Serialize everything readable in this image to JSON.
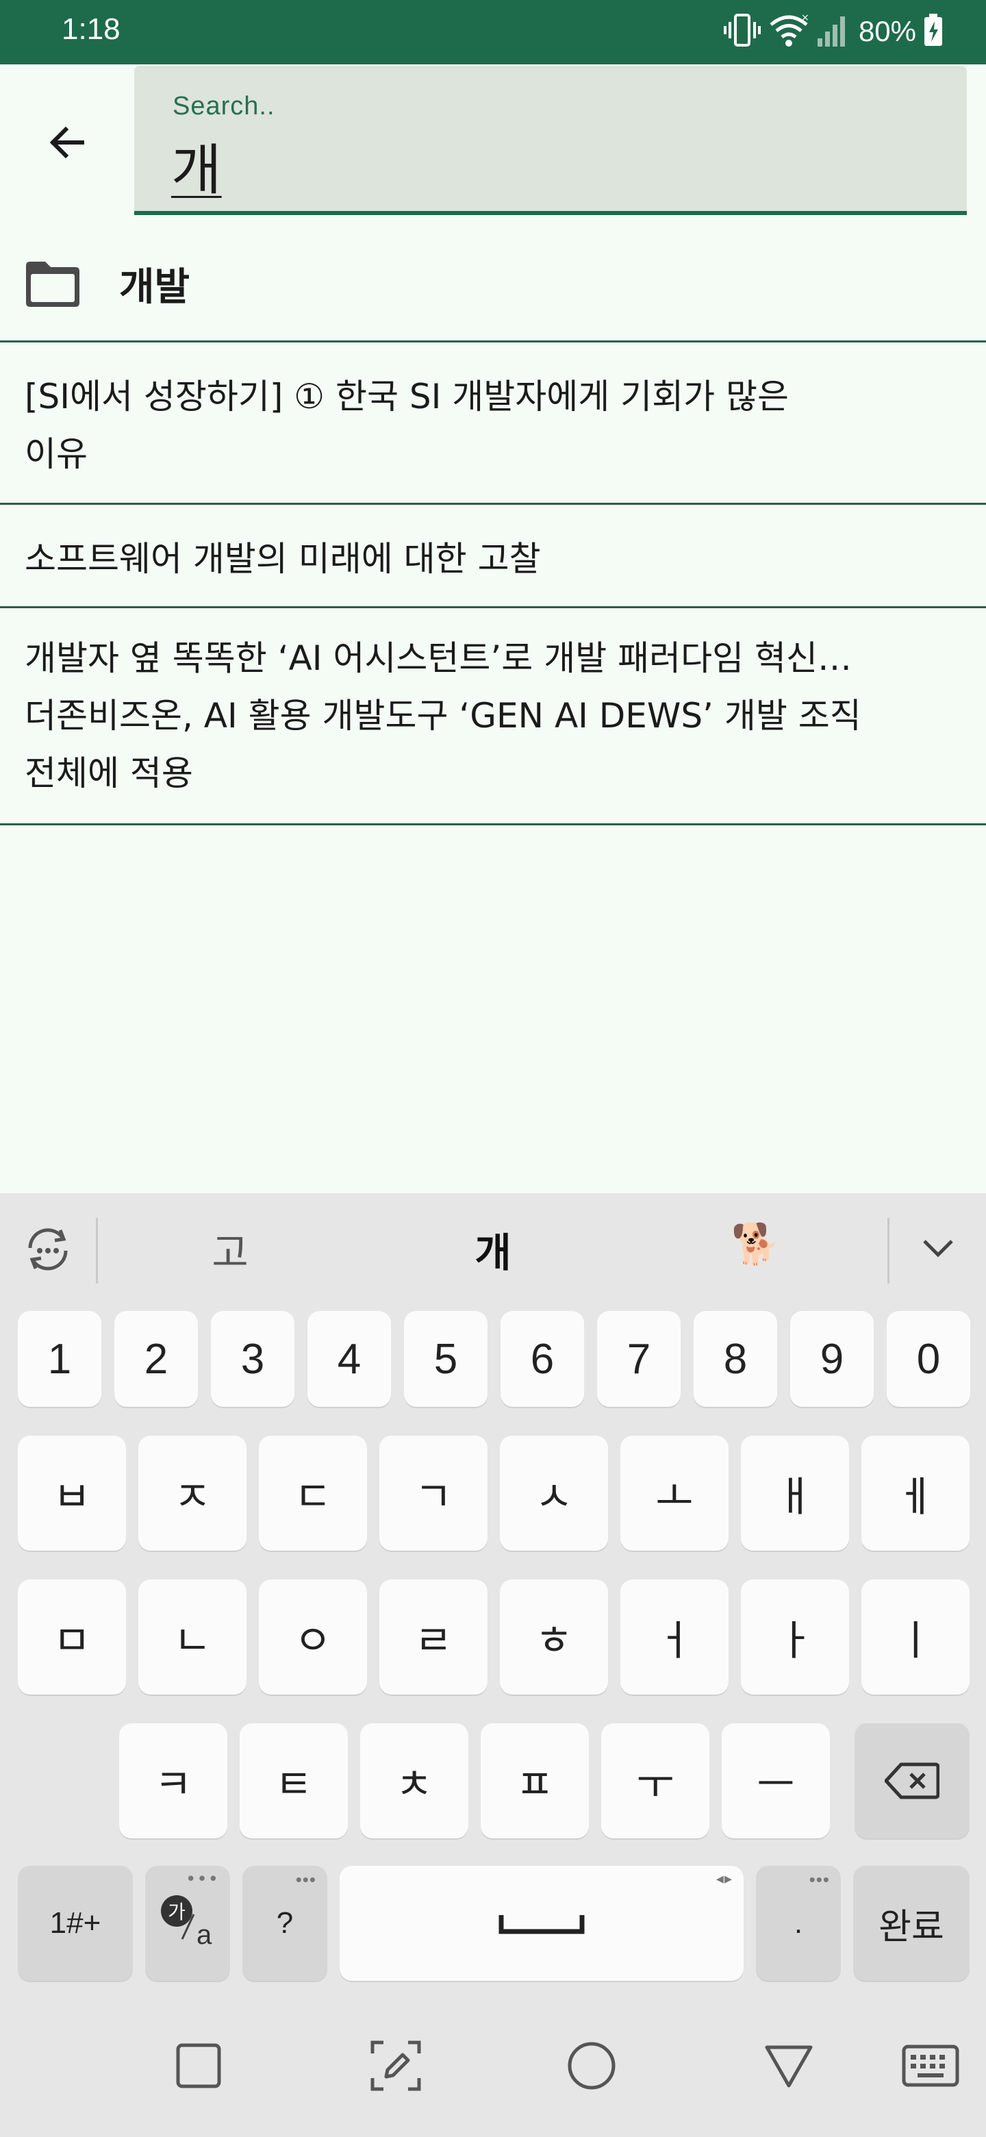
{
  "status": {
    "time": "1:18",
    "battery": "80%",
    "icons": [
      "vibrate-icon",
      "wifi-icon",
      "cell-signal-icon",
      "battery-charging-icon"
    ]
  },
  "search": {
    "label": "Search..",
    "value": "개"
  },
  "results": {
    "folder": {
      "label": "개발",
      "icon": "folder-icon"
    },
    "items": [
      {
        "lines": [
          "[SI에서 성장하기] ① 한국 SI 개발자에게 기회가 많은",
          "이유"
        ]
      },
      {
        "lines": [
          "소프트웨어 개발의 미래에 대한 고찰"
        ]
      },
      {
        "lines": [
          "개발자 옆 똑똑한 ‘AI 어시스턴트’로 개발 패러다임 혁신…",
          "더존비즈온, AI 활용 개발도구 ‘GEN AI DEWS’ 개발 조직",
          "전체에 적용"
        ]
      }
    ]
  },
  "keyboard": {
    "suggestions": [
      "고",
      "개",
      "🐕"
    ],
    "number_row": [
      "1",
      "2",
      "3",
      "4",
      "5",
      "6",
      "7",
      "8",
      "9",
      "0"
    ],
    "row1": [
      "ㅂ",
      "ㅈ",
      "ㄷ",
      "ㄱ",
      "ㅅ",
      "ㅗ",
      "ㅐ",
      "ㅔ"
    ],
    "row2": [
      "ㅁ",
      "ㄴ",
      "ㅇ",
      "ㄹ",
      "ㅎ",
      "ㅓ",
      "ㅏ",
      "ㅣ"
    ],
    "row3": [
      "ㅋ",
      "ㅌ",
      "ㅊ",
      "ㅍ",
      "ㅜ",
      "ㅡ"
    ],
    "symbols_key": "1#+",
    "lang_key_main": "가",
    "lang_key_sub": "a",
    "question_key": "?",
    "period_key": ".",
    "done_key": "완료"
  },
  "colors": {
    "primary": "#1e6b4b",
    "background": "#f4fcf5",
    "search_fill": "#dce4dc",
    "keyboard_bg": "#e6e6e6"
  }
}
